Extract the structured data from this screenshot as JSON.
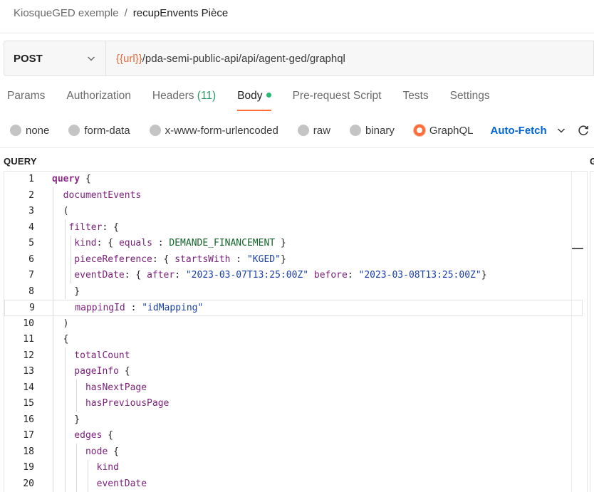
{
  "breadcrumb": {
    "parent": "KiosqueGED exemple",
    "separator": "/",
    "current": "recupEnvents Pièce"
  },
  "request": {
    "method": "POST",
    "url_variable": "{{url}}",
    "url_path": "/pda-semi-public-api/api/agent-ged/graphql"
  },
  "tabs": [
    {
      "label": "Params"
    },
    {
      "label": "Authorization"
    },
    {
      "label": "Headers",
      "count": "(11)"
    },
    {
      "label": "Body"
    },
    {
      "label": "Pre-request Script"
    },
    {
      "label": "Tests"
    },
    {
      "label": "Settings"
    }
  ],
  "body_types": [
    {
      "label": "none"
    },
    {
      "label": "form-data"
    },
    {
      "label": "x-www-form-urlencoded"
    },
    {
      "label": "raw"
    },
    {
      "label": "binary"
    },
    {
      "label": "GraphQL"
    }
  ],
  "auto_fetch": "Auto-Fetch",
  "query_label": "QUERY",
  "right_pane_label": "G",
  "colors": {
    "accent": "#ff6c37",
    "link": "#0265d2",
    "count": "#2b9a66",
    "body_dot": "#2bb673"
  },
  "code_lines": [
    {
      "n": "1",
      "tokens": [
        {
          "t": "query",
          "c": "kw"
        },
        {
          "t": " {",
          "c": "pn"
        }
      ]
    },
    {
      "n": "2",
      "tokens": [
        {
          "t": "  documentEvents",
          "c": "fld"
        }
      ]
    },
    {
      "n": "3",
      "tokens": [
        {
          "t": "  (",
          "c": "pn"
        }
      ]
    },
    {
      "n": "4",
      "tokens": [
        {
          "t": "   filter",
          "c": "fld"
        },
        {
          "t": ": {",
          "c": "pn"
        }
      ]
    },
    {
      "n": "5",
      "tokens": [
        {
          "t": "    kind",
          "c": "fld"
        },
        {
          "t": ": { ",
          "c": "pn"
        },
        {
          "t": "equals",
          "c": "fld"
        },
        {
          "t": " : ",
          "c": "pn"
        },
        {
          "t": "DEMANDE_FINANCEMENT",
          "c": "en"
        },
        {
          "t": " }",
          "c": "pn"
        }
      ]
    },
    {
      "n": "6",
      "tokens": [
        {
          "t": "    pieceReference",
          "c": "fld"
        },
        {
          "t": ": { ",
          "c": "pn"
        },
        {
          "t": "startsWith",
          "c": "fld"
        },
        {
          "t": " : ",
          "c": "pn"
        },
        {
          "t": "\"KGED\"",
          "c": "str"
        },
        {
          "t": "}",
          "c": "pn"
        }
      ]
    },
    {
      "n": "7",
      "tokens": [
        {
          "t": "    eventDate",
          "c": "fld"
        },
        {
          "t": ": { ",
          "c": "pn"
        },
        {
          "t": "after",
          "c": "fld"
        },
        {
          "t": ": ",
          "c": "pn"
        },
        {
          "t": "\"2023-03-07T13:25:00Z\"",
          "c": "str"
        },
        {
          "t": " ",
          "c": "pn"
        },
        {
          "t": "before",
          "c": "fld"
        },
        {
          "t": ": ",
          "c": "pn"
        },
        {
          "t": "\"2023-03-08T13:25:00Z\"",
          "c": "str"
        },
        {
          "t": "}",
          "c": "pn"
        }
      ]
    },
    {
      "n": "8",
      "tokens": [
        {
          "t": "    }",
          "c": "pn"
        }
      ]
    },
    {
      "n": "9",
      "tokens": [
        {
          "t": "    mappingId",
          "c": "fld"
        },
        {
          "t": " : ",
          "c": "pn"
        },
        {
          "t": "\"idMapping\"",
          "c": "str"
        }
      ]
    },
    {
      "n": "10",
      "tokens": [
        {
          "t": "  )",
          "c": "pn"
        }
      ]
    },
    {
      "n": "11",
      "tokens": [
        {
          "t": "  {",
          "c": "pn"
        }
      ]
    },
    {
      "n": "12",
      "tokens": [
        {
          "t": "    totalCount",
          "c": "fld"
        }
      ]
    },
    {
      "n": "13",
      "tokens": [
        {
          "t": "    pageInfo",
          "c": "fld"
        },
        {
          "t": " {",
          "c": "pn"
        }
      ]
    },
    {
      "n": "14",
      "tokens": [
        {
          "t": "      hasNextPage",
          "c": "fld"
        }
      ]
    },
    {
      "n": "15",
      "tokens": [
        {
          "t": "      hasPreviousPage",
          "c": "fld"
        }
      ]
    },
    {
      "n": "16",
      "tokens": [
        {
          "t": "    }",
          "c": "pn"
        }
      ]
    },
    {
      "n": "17",
      "tokens": [
        {
          "t": "    edges",
          "c": "fld"
        },
        {
          "t": " {",
          "c": "pn"
        }
      ]
    },
    {
      "n": "18",
      "tokens": [
        {
          "t": "      node",
          "c": "fld"
        },
        {
          "t": " {",
          "c": "pn"
        }
      ]
    },
    {
      "n": "19",
      "tokens": [
        {
          "t": "        kind",
          "c": "fld"
        }
      ]
    },
    {
      "n": "20",
      "tokens": [
        {
          "t": "        eventDate",
          "c": "fld"
        }
      ]
    }
  ]
}
